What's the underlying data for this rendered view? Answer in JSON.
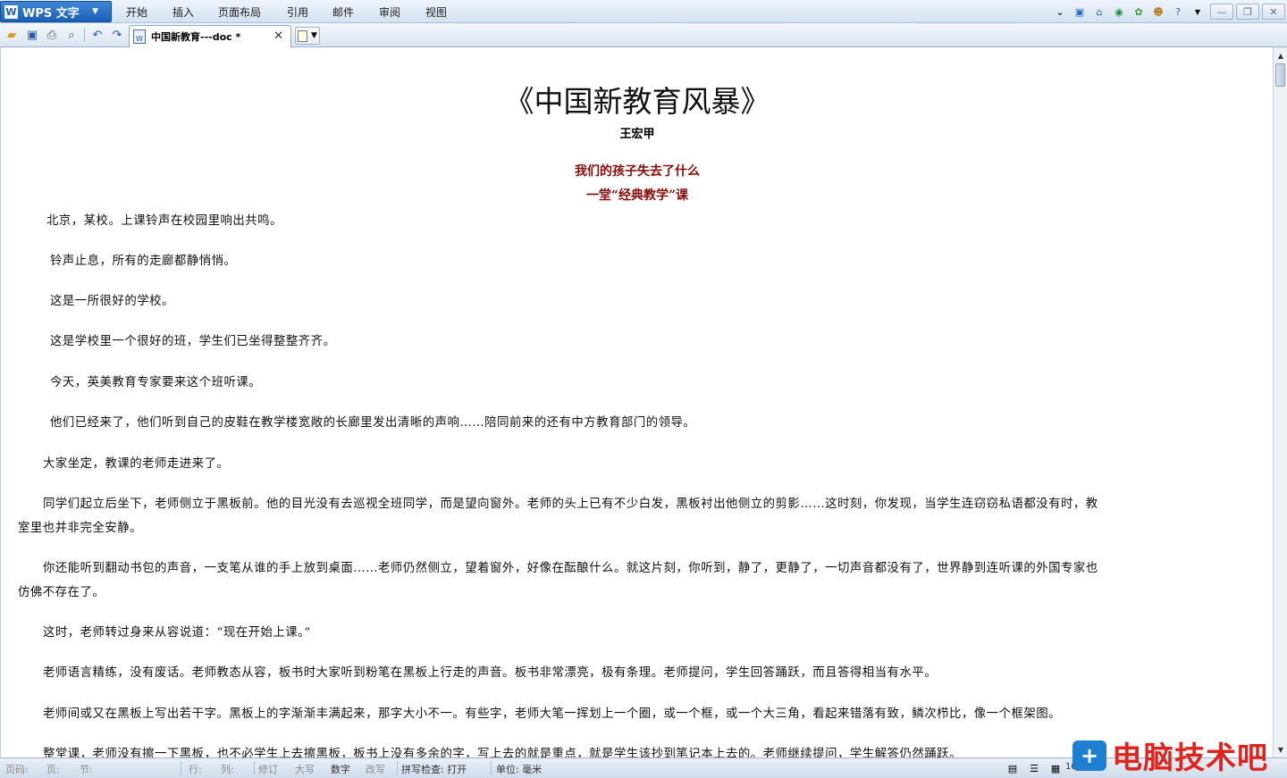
{
  "app": {
    "name": "WPS 文字"
  },
  "menu": {
    "items": [
      "开始",
      "插入",
      "页面布局",
      "引用",
      "邮件",
      "审阅",
      "视图"
    ]
  },
  "tab": {
    "label": "中国新教育---doc *"
  },
  "document": {
    "title": "《中国新教育风暴》",
    "author": "王宏甲",
    "sub1": "我们的孩子失去了什么",
    "sub2": "一堂“经典教学”课",
    "paragraphs": [
      "北京，某校。上课铃声在校园里响出共鸣。",
      "铃声止息，所有的走廊都静悄悄。",
      "这是一所很好的学校。",
      "这是学校里一个很好的班，学生们已坐得整整齐齐。",
      "今天，英美教育专家要来这个班听课。",
      "他们已经来了，他们听到自己的皮鞋在教学楼宽敞的长廊里发出清晰的声响……陪同前来的还有中方教育部门的领导。",
      "大家坐定，教课的老师走进来了。",
      "同学们起立后坐下，老师侧立于黑板前。他的目光没有去巡视全班同学，而是望向窗外。老师的头上已有不少白发，黑板衬出他侧立的剪影……这时刻，你发现，当学生连窃窃私语都没有时，教",
      "室里也并非完全安静。",
      "你还能听到翻动书包的声音，一支笔从谁的手上放到桌面……老师仍然侧立，望着窗外，好像在酝酿什么。就这片刻，你听到，静了，更静了，一切声音都没有了，世界静到连听课的外国专家也",
      "仿佛不存在了。",
      "这时，老师转过身来从容说道：“现在开始上课。”",
      "老师语言精练，没有废话。老师教态从容，板书时大家听到粉笔在黑板上行走的声音。板书非常漂亮，极有条理。老师提问，学生回答踊跃，而且答得相当有水平。",
      "老师间或又在黑板上写出若干字。黑板上的字渐渐丰满起来，那字大小不一。有些字，老师大笔一挥划上一个圈，或一个框，或一个大三角，看起来错落有致，鳞次栉比，像一个框架图。",
      "整堂课，老师没有擦一下黑板，也不必学生上去擦黑板，板书上没有多余的字，写上去的就是重点，就是学生该抄到笔记本上去的。老师继续提问，学生解答仍然踊跃。"
    ]
  },
  "status": {
    "page": "页码:",
    "section_page": "页:",
    "section": "节:",
    "row": "行:",
    "col": "列:",
    "revise": "修订",
    "caps": "大写",
    "num": "数字",
    "overwrite": "改写",
    "spell": "拼写检查: 打开",
    "unit": "单位: 毫米",
    "zoom": "103 %"
  },
  "watermark": {
    "text": "电脑技术吧"
  },
  "colors": {
    "accent": "#1b5fb8",
    "subtitle": "#8a0b0b",
    "watermark": "#e0231c"
  }
}
